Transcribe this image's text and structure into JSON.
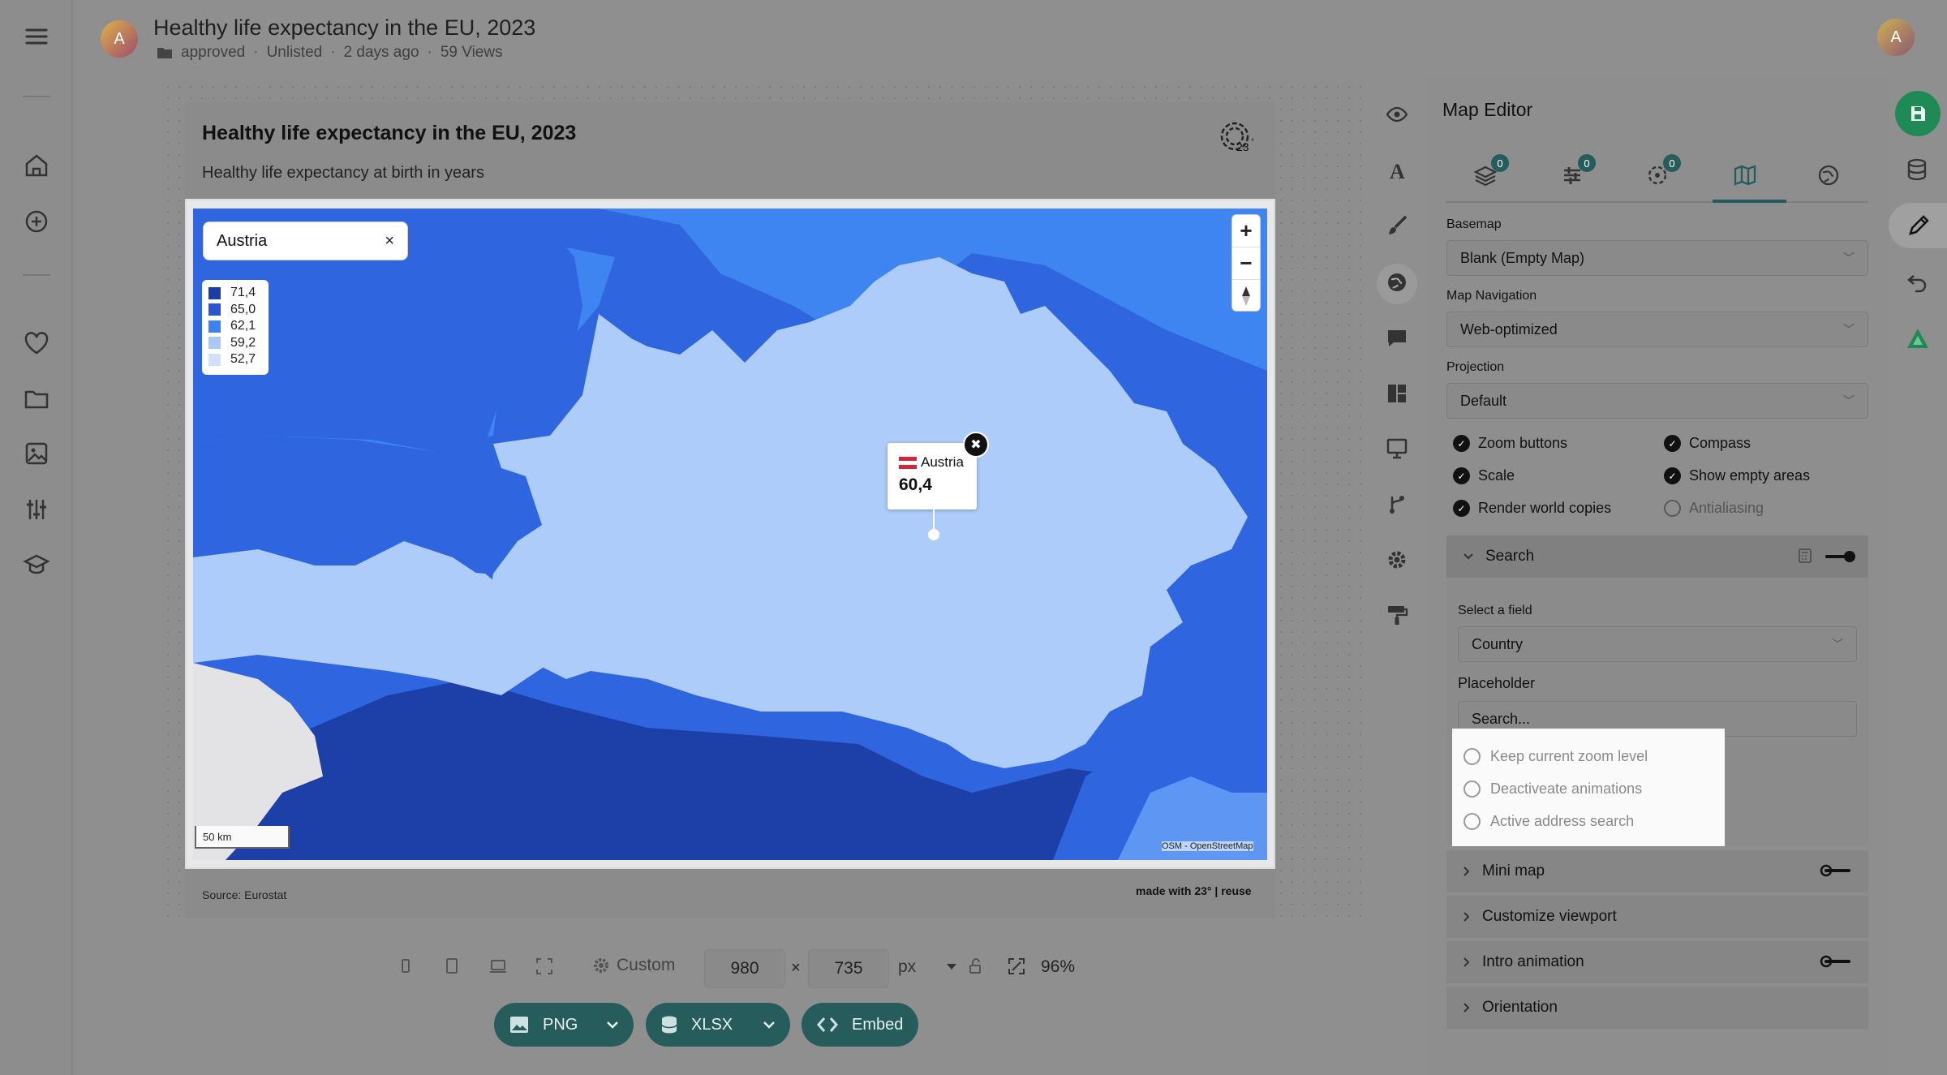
{
  "header": {
    "title": "Healthy life expectancy in the EU, 2023",
    "folder": "approved",
    "visibility": "Unlisted",
    "updated": "2 days ago",
    "views": "59 Views",
    "avatar_letter": "A"
  },
  "nav": {
    "icons": [
      "menu-icon",
      "home-icon",
      "plus-circle-icon",
      "heart-icon",
      "folder-icon",
      "image-icon",
      "sliders-icon",
      "graduation-icon"
    ]
  },
  "chart": {
    "title": "Healthy life expectancy in the EU, 2023",
    "subtitle": "Healthy life expectancy at birth in years",
    "source": "Source: Eurostat",
    "made_with": "made with 23° | reuse",
    "search_value": "Austria",
    "search_clear": "×",
    "legend": [
      {
        "label": "71,4",
        "color": "#1a3ea3"
      },
      {
        "label": "65,0",
        "color": "#2a55d2"
      },
      {
        "label": "62,1",
        "color": "#3d82f1"
      },
      {
        "label": "59,2",
        "color": "#a9c7f7"
      },
      {
        "label": "52,7",
        "color": "#d2e1fb"
      }
    ],
    "zoom_in": "+",
    "zoom_out": "−",
    "scale": "50 km",
    "attribution": "OSM - OpenStreetMap",
    "tooltip": {
      "country": "Austria",
      "value": "60,4",
      "close": "✖"
    },
    "colors": {
      "austria": "#adccf9",
      "dark": "#1c3fa8",
      "mid": "#2f66e0",
      "light": "#3f85f2",
      "water": "#e3e3e5"
    }
  },
  "toolbar": {
    "custom_label": "Custom",
    "width": "980",
    "times": "×",
    "height": "735",
    "unit": "px",
    "zoom": "96%",
    "png": "PNG",
    "xlsx": "XLSX",
    "embed": "Embed"
  },
  "panel": {
    "title": "Map Editor",
    "tabs": [
      {
        "name": "layers",
        "badge": "0"
      },
      {
        "name": "filters",
        "badge": "0"
      },
      {
        "name": "markers",
        "badge": "0"
      },
      {
        "name": "map",
        "badge": ""
      },
      {
        "name": "globe",
        "badge": ""
      }
    ],
    "basemap_label": "Basemap",
    "basemap_value": "Blank (Empty Map)",
    "navigation_label": "Map Navigation",
    "navigation_value": "Web-optimized",
    "projection_label": "Projection",
    "projection_value": "Default",
    "checks": [
      {
        "label": "Zoom buttons",
        "checked": true
      },
      {
        "label": "Compass",
        "checked": true
      },
      {
        "label": "Scale",
        "checked": true
      },
      {
        "label": "Show empty areas",
        "checked": true
      },
      {
        "label": "Render world copies",
        "checked": true
      },
      {
        "label": "Antialiasing",
        "checked": false
      }
    ],
    "search_section": "Search",
    "select_field_label": "Select a field",
    "select_field_value": "Country",
    "placeholder_label": "Placeholder",
    "placeholder_value": "Search...",
    "radios": [
      "Keep current zoom level",
      "Deactiveate animations",
      "Active address search"
    ],
    "sections": [
      "Mini map",
      "Customize viewport",
      "Intro animation",
      "Orientation"
    ]
  }
}
